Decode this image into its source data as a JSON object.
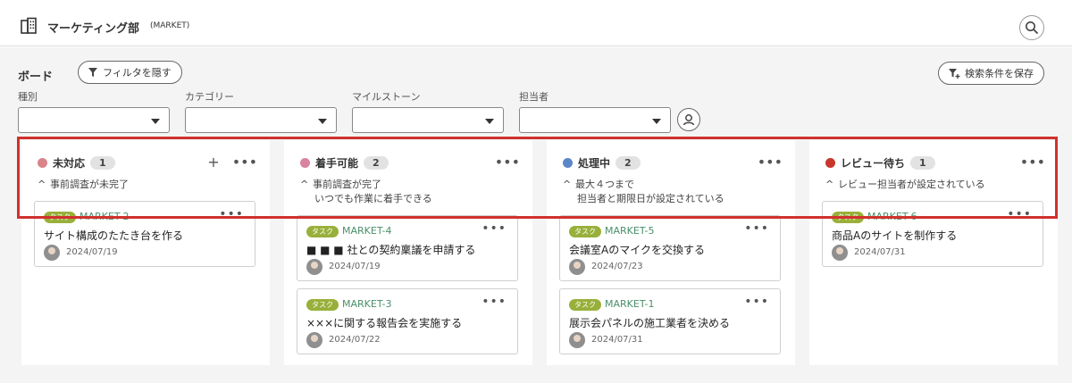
{
  "header": {
    "project_icon": "building-icon",
    "project_name": "マーケティング部",
    "project_key": "(MARKET)",
    "search_icon": "search-icon"
  },
  "board": {
    "title": "ボード",
    "filter_button": "フィルタを隠す",
    "save_button": "検索条件を保存",
    "filters": [
      {
        "label": "種別",
        "value": ""
      },
      {
        "label": "カテゴリー",
        "value": ""
      },
      {
        "label": "マイルストーン",
        "value": ""
      },
      {
        "label": "担当者",
        "value": ""
      }
    ]
  },
  "columns": [
    {
      "title": "未対応",
      "count": "1",
      "color": "#d9848a",
      "condition": [
        "事前調査が未完了"
      ],
      "cards": [
        {
          "tag": "タスク",
          "key": "MARKET-2",
          "title": "サイト構成のたたき台を作る",
          "date": "2024/07/19"
        }
      ]
    },
    {
      "title": "着手可能",
      "count": "2",
      "color": "#d883a2",
      "condition": [
        "事前調査が完了",
        "いつでも作業に着手できる"
      ],
      "cards": [
        {
          "tag": "タスク",
          "key": "MARKET-4",
          "title": "■ ■ ■ 社との契約稟議を申請する",
          "date": "2024/07/19"
        },
        {
          "tag": "タスク",
          "key": "MARKET-3",
          "title": "×××に関する報告会を実施する",
          "date": "2024/07/22"
        }
      ]
    },
    {
      "title": "処理中",
      "count": "2",
      "color": "#5b86c9",
      "condition": [
        "最大４つまで",
        "担当者と期限日が設定されている"
      ],
      "cards": [
        {
          "tag": "タスク",
          "key": "MARKET-5",
          "title": "会議室Aのマイクを交換する",
          "date": "2024/07/23"
        },
        {
          "tag": "タスク",
          "key": "MARKET-1",
          "title": "展示会パネルの施工業者を決める",
          "date": "2024/07/31"
        }
      ]
    },
    {
      "title": "レビュー待ち",
      "count": "1",
      "color": "#c9372c",
      "condition": [
        "レビュー担当者が設定されている"
      ],
      "cards": [
        {
          "tag": "タスク",
          "key": "MARKET-6",
          "title": "商品Aのサイトを制作する",
          "date": "2024/07/31"
        }
      ]
    }
  ]
}
